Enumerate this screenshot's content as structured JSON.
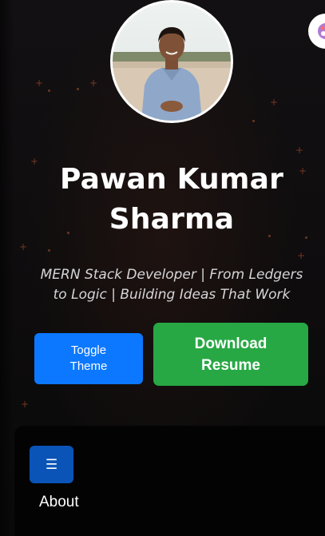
{
  "profile": {
    "name": "Pawan Kumar Sharma",
    "tagline": "MERN Stack Developer | From Ledgers to Logic | Building Ideas That Work",
    "avatar_icon": "profile-photo"
  },
  "actions": {
    "toggle_theme_label": "Toggle Theme",
    "download_resume_label": "Download Resume"
  },
  "theme_fab": {
    "icon": "palette-icon"
  },
  "nav": {
    "menu_icon": "☰",
    "items": [
      {
        "label": "About"
      }
    ]
  },
  "colors": {
    "toggle_button": "#0b78ff",
    "resume_button": "#27a844",
    "menu_button": "#0a54b8",
    "background": "#0d0d0e"
  }
}
